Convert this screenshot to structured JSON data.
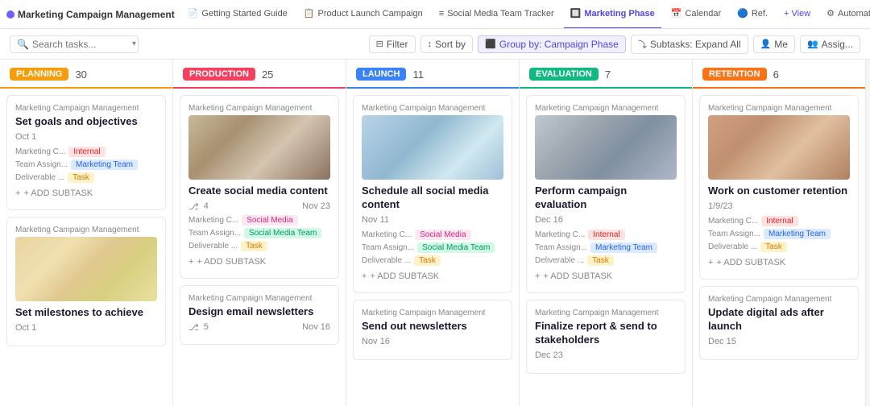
{
  "app": {
    "title": "Marketing Campaign Management",
    "tabs": [
      {
        "label": "Getting Started Guide",
        "icon": "📄",
        "active": false
      },
      {
        "label": "Product Launch Campaign",
        "icon": "📋",
        "active": false
      },
      {
        "label": "Social Media Team Tracker",
        "icon": "≡",
        "active": false
      },
      {
        "label": "Marketing Phase",
        "icon": "🔲",
        "active": true
      },
      {
        "label": "Calendar",
        "icon": "📅",
        "active": false
      },
      {
        "label": "Ref.",
        "icon": "🔵",
        "active": false
      },
      {
        "label": "+ View",
        "icon": "",
        "active": false
      },
      {
        "label": "Automati...",
        "icon": "⚙",
        "active": false
      }
    ]
  },
  "toolbar": {
    "search_placeholder": "Search tasks...",
    "filter_label": "Filter",
    "sort_label": "Sort by",
    "group_label": "Group by: Campaign Phase",
    "subtasks_label": "Subtasks: Expand All",
    "me_label": "Me",
    "assigni_label": "Assig..."
  },
  "columns": [
    {
      "id": "planning",
      "badge": "PLANNING",
      "count": "30",
      "badge_class": "badge-planning",
      "line_class": "col-line-planning",
      "cards": [
        {
          "id": "p1",
          "project": "Marketing Campaign Management",
          "title": "Set goals and objectives",
          "date": "Oct 1",
          "tags_row1_label": "Marketing C...",
          "tags_row1": [
            {
              "label": "Internal",
              "class": "tag-internal"
            }
          ],
          "tags_row2_label": "Team Assign...",
          "tags_row2": [
            {
              "label": "Marketing Team",
              "class": "tag-marketing-team"
            }
          ],
          "tags_row3_label": "Deliverable ...",
          "tags_row3": [
            {
              "label": "Task",
              "class": "tag-task"
            }
          ],
          "has_add_subtask": true,
          "add_subtask_label": "+ ADD SUBTASK",
          "has_img": false,
          "img_class": ""
        },
        {
          "id": "p2",
          "project": "Marketing Campaign Management",
          "title": "Set milestones to achieve",
          "date": "Oct 1",
          "tags_row1_label": "",
          "tags_row1": [],
          "tags_row2_label": "",
          "tags_row2": [],
          "tags_row3_label": "",
          "tags_row3": [],
          "has_add_subtask": false,
          "add_subtask_label": "",
          "has_img": true,
          "img_class": "img-sticky"
        }
      ]
    },
    {
      "id": "production",
      "badge": "PRODUCTION",
      "count": "25",
      "badge_class": "badge-production",
      "line_class": "col-line-production",
      "cards": [
        {
          "id": "pr1",
          "project": "Marketing Campaign Management",
          "title": "Create social media content",
          "date": "Nov 23",
          "subtask_count": "4",
          "tags_row1_label": "Marketing C...",
          "tags_row1": [
            {
              "label": "Social Media",
              "class": "tag-social-media"
            }
          ],
          "tags_row2_label": "Team Assign...",
          "tags_row2": [
            {
              "label": "Social Media Team",
              "class": "tag-social-media-team"
            }
          ],
          "tags_row3_label": "Deliverable ...",
          "tags_row3": [
            {
              "label": "Task",
              "class": "tag-task"
            }
          ],
          "has_add_subtask": true,
          "add_subtask_label": "+ ADD SUBTASK",
          "has_img": true,
          "img_class": "img-workbench"
        },
        {
          "id": "pr2",
          "project": "Marketing Campaign Management",
          "title": "Design email newsletters",
          "date": "Nov 16",
          "subtask_count": "5",
          "tags_row1_label": "",
          "tags_row1": [],
          "tags_row2_label": "",
          "tags_row2": [],
          "tags_row3_label": "",
          "tags_row3": [],
          "has_add_subtask": false,
          "add_subtask_label": "",
          "has_img": false,
          "img_class": ""
        }
      ]
    },
    {
      "id": "launch",
      "badge": "LAUNCH",
      "count": "11",
      "badge_class": "badge-launch",
      "line_class": "col-line-launch",
      "cards": [
        {
          "id": "l1",
          "project": "Marketing Campaign Management",
          "title": "Schedule all social media content",
          "date": "Nov 11",
          "subtask_count": "",
          "tags_row1_label": "Marketing C...",
          "tags_row1": [
            {
              "label": "Social Media",
              "class": "tag-social-media"
            }
          ],
          "tags_row2_label": "Team Assign...",
          "tags_row2": [
            {
              "label": "Social Media Team",
              "class": "tag-social-media-team"
            }
          ],
          "tags_row3_label": "Deliverable ...",
          "tags_row3": [
            {
              "label": "Task",
              "class": "tag-task"
            }
          ],
          "has_add_subtask": true,
          "add_subtask_label": "+ ADD SUBTASK",
          "has_img": true,
          "img_class": "img-calendar"
        },
        {
          "id": "l2",
          "project": "Marketing Campaign Management",
          "title": "Send out newsletters",
          "date": "Nov 16",
          "subtask_count": "",
          "tags_row1_label": "",
          "tags_row1": [],
          "tags_row2_label": "",
          "tags_row2": [],
          "tags_row3_label": "",
          "tags_row3": [],
          "has_add_subtask": false,
          "add_subtask_label": "",
          "has_img": false,
          "img_class": ""
        }
      ]
    },
    {
      "id": "evaluation",
      "badge": "EVALUATION",
      "count": "7",
      "badge_class": "badge-evaluation",
      "line_class": "col-line-evaluation",
      "cards": [
        {
          "id": "e1",
          "project": "Marketing Campaign Management",
          "title": "Perform campaign evaluation",
          "date": "Dec 16",
          "subtask_count": "",
          "tags_row1_label": "Marketing C...",
          "tags_row1": [
            {
              "label": "Internal",
              "class": "tag-internal"
            }
          ],
          "tags_row2_label": "Team Assign...",
          "tags_row2": [
            {
              "label": "Marketing Team",
              "class": "tag-marketing-team"
            }
          ],
          "tags_row3_label": "Deliverable ...",
          "tags_row3": [
            {
              "label": "Task",
              "class": "tag-task"
            }
          ],
          "has_add_subtask": true,
          "add_subtask_label": "+ ADD SUBTASK",
          "has_img": true,
          "img_class": "img-keyboard"
        },
        {
          "id": "e2",
          "project": "Marketing Campaign Management",
          "title": "Finalize report & send to stakeholders",
          "date": "Dec 23",
          "subtask_count": "",
          "tags_row1_label": "",
          "tags_row1": [],
          "tags_row2_label": "",
          "tags_row2": [],
          "tags_row3_label": "",
          "tags_row3": [],
          "has_add_subtask": false,
          "add_subtask_label": "",
          "has_img": false,
          "img_class": ""
        }
      ]
    },
    {
      "id": "retention",
      "badge": "RETENTION",
      "count": "6",
      "badge_class": "badge-retention",
      "line_class": "col-line-retention",
      "cards": [
        {
          "id": "r1",
          "project": "Marketing Campaign Management",
          "title": "Work on customer retention",
          "date": "1/9/23",
          "subtask_count": "",
          "tags_row1_label": "Marketing C...",
          "tags_row1": [
            {
              "label": "Internal",
              "class": "tag-internal"
            }
          ],
          "tags_row2_label": "Team Assign...",
          "tags_row2": [
            {
              "label": "Marketing Team",
              "class": "tag-marketing-team"
            }
          ],
          "tags_row3_label": "Deliverable ...",
          "tags_row3": [
            {
              "label": "Task",
              "class": "tag-task"
            }
          ],
          "has_add_subtask": true,
          "add_subtask_label": "+ ADD SUBTASK",
          "has_img": true,
          "img_class": "img-person"
        },
        {
          "id": "r2",
          "project": "Marketing Campaign Management",
          "title": "Update digital ads after launch",
          "date": "Dec 15",
          "subtask_count": "",
          "tags_row1_label": "",
          "tags_row1": [],
          "tags_row2_label": "",
          "tags_row2": [],
          "tags_row3_label": "",
          "tags_row3": [],
          "has_add_subtask": false,
          "add_subtask_label": "",
          "has_img": false,
          "img_class": ""
        }
      ]
    }
  ]
}
